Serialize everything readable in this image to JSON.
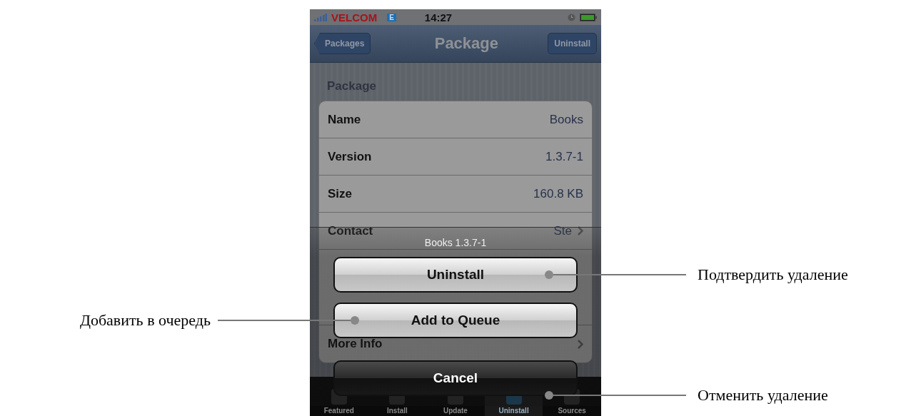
{
  "status_bar": {
    "carrier": "VELCOM",
    "network": "E",
    "time": "14:27"
  },
  "nav_bar": {
    "back_button": "Packages",
    "title": "Package",
    "action_button": "Uninstall"
  },
  "section_title": "Package",
  "rows": [
    {
      "kind": "field",
      "label": "Name",
      "value": "Books"
    },
    {
      "kind": "field",
      "label": "Version",
      "value": "1.3.7-1"
    },
    {
      "kind": "field",
      "label": "Size",
      "value": "160.8 KB"
    },
    {
      "kind": "link",
      "label": "Contact",
      "value": "Ste"
    },
    {
      "kind": "description"
    },
    {
      "kind": "link",
      "label": "More Info"
    }
  ],
  "action_sheet": {
    "title": "Books 1.3.7-1",
    "buttons": [
      {
        "label": "Uninstall",
        "kind": "light",
        "callout": {
          "text": "Подтвердить удаление",
          "kind": "right"
        }
      },
      {
        "label": "Add to Queue",
        "kind": "light",
        "callout": {
          "text": "Добавить в очередь",
          "kind": "left"
        }
      },
      {
        "label": "Cancel",
        "kind": "dark",
        "callout": {
          "text": "Отменить удаление",
          "kind": "right"
        }
      }
    ]
  },
  "tab_bar": [
    {
      "label": "Featured",
      "selected": false
    },
    {
      "label": "Install",
      "selected": false
    },
    {
      "label": "Update",
      "selected": false
    },
    {
      "label": "Uninstall",
      "selected": true
    },
    {
      "label": "Sources",
      "selected": false
    }
  ]
}
